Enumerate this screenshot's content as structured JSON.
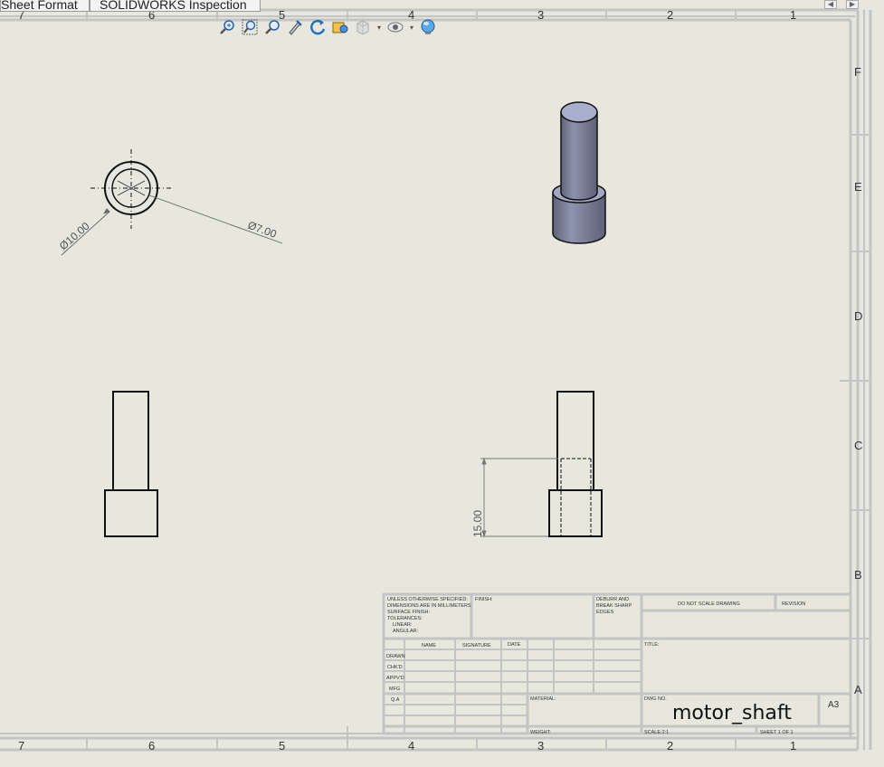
{
  "tabs": [
    {
      "label": "Sheet Format"
    },
    {
      "label": "SOLIDWORKS Inspection"
    }
  ],
  "toolbar": [
    {
      "icon": "zoom-to-fit-icon"
    },
    {
      "icon": "zoom-to-area-icon"
    },
    {
      "icon": "zoom-in-out-icon"
    },
    {
      "icon": "select-icon"
    },
    {
      "icon": "rotate-icon"
    },
    {
      "icon": "pan-icon"
    },
    {
      "icon": "display-style-icon"
    },
    {
      "icon": "hide-show-icon"
    },
    {
      "icon": "appearance-icon"
    }
  ],
  "zones": {
    "columns": [
      "7",
      "6",
      "5",
      "4",
      "3",
      "2",
      "1"
    ],
    "rows": [
      "F",
      "E",
      "D",
      "C",
      "B",
      "A"
    ]
  },
  "dimensions": {
    "outer_diameter": "Ø10.00",
    "inner_diameter": "Ø7.00",
    "height": "15.00"
  },
  "title_block": {
    "tolerance_note": [
      "UNLESS OTHERWISE SPECIFIED:",
      "DIMENSIONS ARE IN MILLIMETERS",
      "SURFACE FINISH:",
      "TOLERANCES:",
      "LINEAR:",
      "ANGULAR:"
    ],
    "finish": "FINISH:",
    "deburr": [
      "DEBURR AND",
      "BREAK SHARP",
      "EDGES"
    ],
    "do_not_scale": "DO NOT SCALE DRAWING",
    "revision": "REVISION",
    "col_name": "NAME",
    "col_signature": "SIGNATURE",
    "col_date": "DATE",
    "row_labels": [
      "DRAWN",
      "CHK'D",
      "APPV'D",
      "MFG",
      "Q.A"
    ],
    "title": "TITLE:",
    "material": "MATERIAL:",
    "dwg_no": "DWG NO.",
    "drawing_name": "motor_shaft",
    "sheet_size": "A3",
    "weight": "WEIGHT:",
    "scale": "SCALE:2:1",
    "sheet": "SHEET 1 OF 1"
  }
}
